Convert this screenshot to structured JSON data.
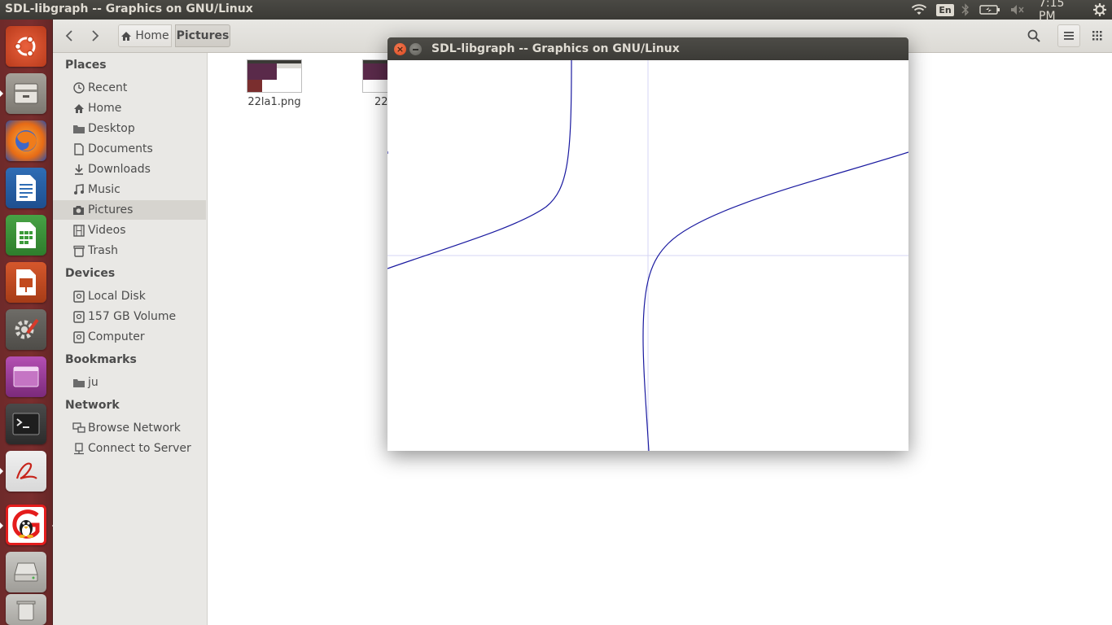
{
  "top_panel": {
    "title": "SDL-libgraph -- Graphics on GNU/Linux",
    "language": "En",
    "clock": "7:15 PM"
  },
  "launcher": {
    "items": [
      {
        "name": "ubuntu-dash-icon"
      },
      {
        "name": "files-icon"
      },
      {
        "name": "firefox-icon"
      },
      {
        "name": "libreoffice-writer-icon"
      },
      {
        "name": "libreoffice-calc-icon"
      },
      {
        "name": "libreoffice-impress-icon"
      },
      {
        "name": "system-settings-icon"
      },
      {
        "name": "workspace-switcher-icon"
      },
      {
        "name": "terminal-icon"
      },
      {
        "name": "pdf-reader-icon"
      },
      {
        "name": "sdl-libgraph-icon"
      },
      {
        "name": "drive-icon"
      },
      {
        "name": "trash-icon"
      }
    ]
  },
  "toolbar": {
    "home_label": "Home",
    "current_label": "Pictures"
  },
  "sidebar": {
    "places_heading": "Places",
    "places": [
      {
        "label": "Recent",
        "icon": "clock-icon"
      },
      {
        "label": "Home",
        "icon": "home-icon"
      },
      {
        "label": "Desktop",
        "icon": "folder-icon"
      },
      {
        "label": "Documents",
        "icon": "document-icon"
      },
      {
        "label": "Downloads",
        "icon": "download-icon"
      },
      {
        "label": "Music",
        "icon": "music-icon"
      },
      {
        "label": "Pictures",
        "icon": "camera-icon",
        "active": true
      },
      {
        "label": "Videos",
        "icon": "film-icon"
      },
      {
        "label": "Trash",
        "icon": "trash-icon"
      }
    ],
    "devices_heading": "Devices",
    "devices": [
      {
        "label": "Local Disk",
        "icon": "drive-icon"
      },
      {
        "label": "157 GB Volume",
        "icon": "drive-icon"
      },
      {
        "label": "Computer",
        "icon": "drive-icon"
      }
    ],
    "bookmarks_heading": "Bookmarks",
    "bookmarks": [
      {
        "label": "ju",
        "icon": "folder-icon"
      }
    ],
    "network_heading": "Network",
    "network": [
      {
        "label": "Browse Network",
        "icon": "network-icon"
      },
      {
        "label": "Connect to Server",
        "icon": "server-icon"
      }
    ]
  },
  "files": [
    {
      "name": "22la1.png"
    },
    {
      "name": "22"
    }
  ],
  "sdl_window": {
    "title": "SDL-libgraph -- Graphics on GNU/Linux",
    "close_glyph": "×",
    "axis_color": "#d4d4f4",
    "curve_color": "#1a1aa0"
  }
}
